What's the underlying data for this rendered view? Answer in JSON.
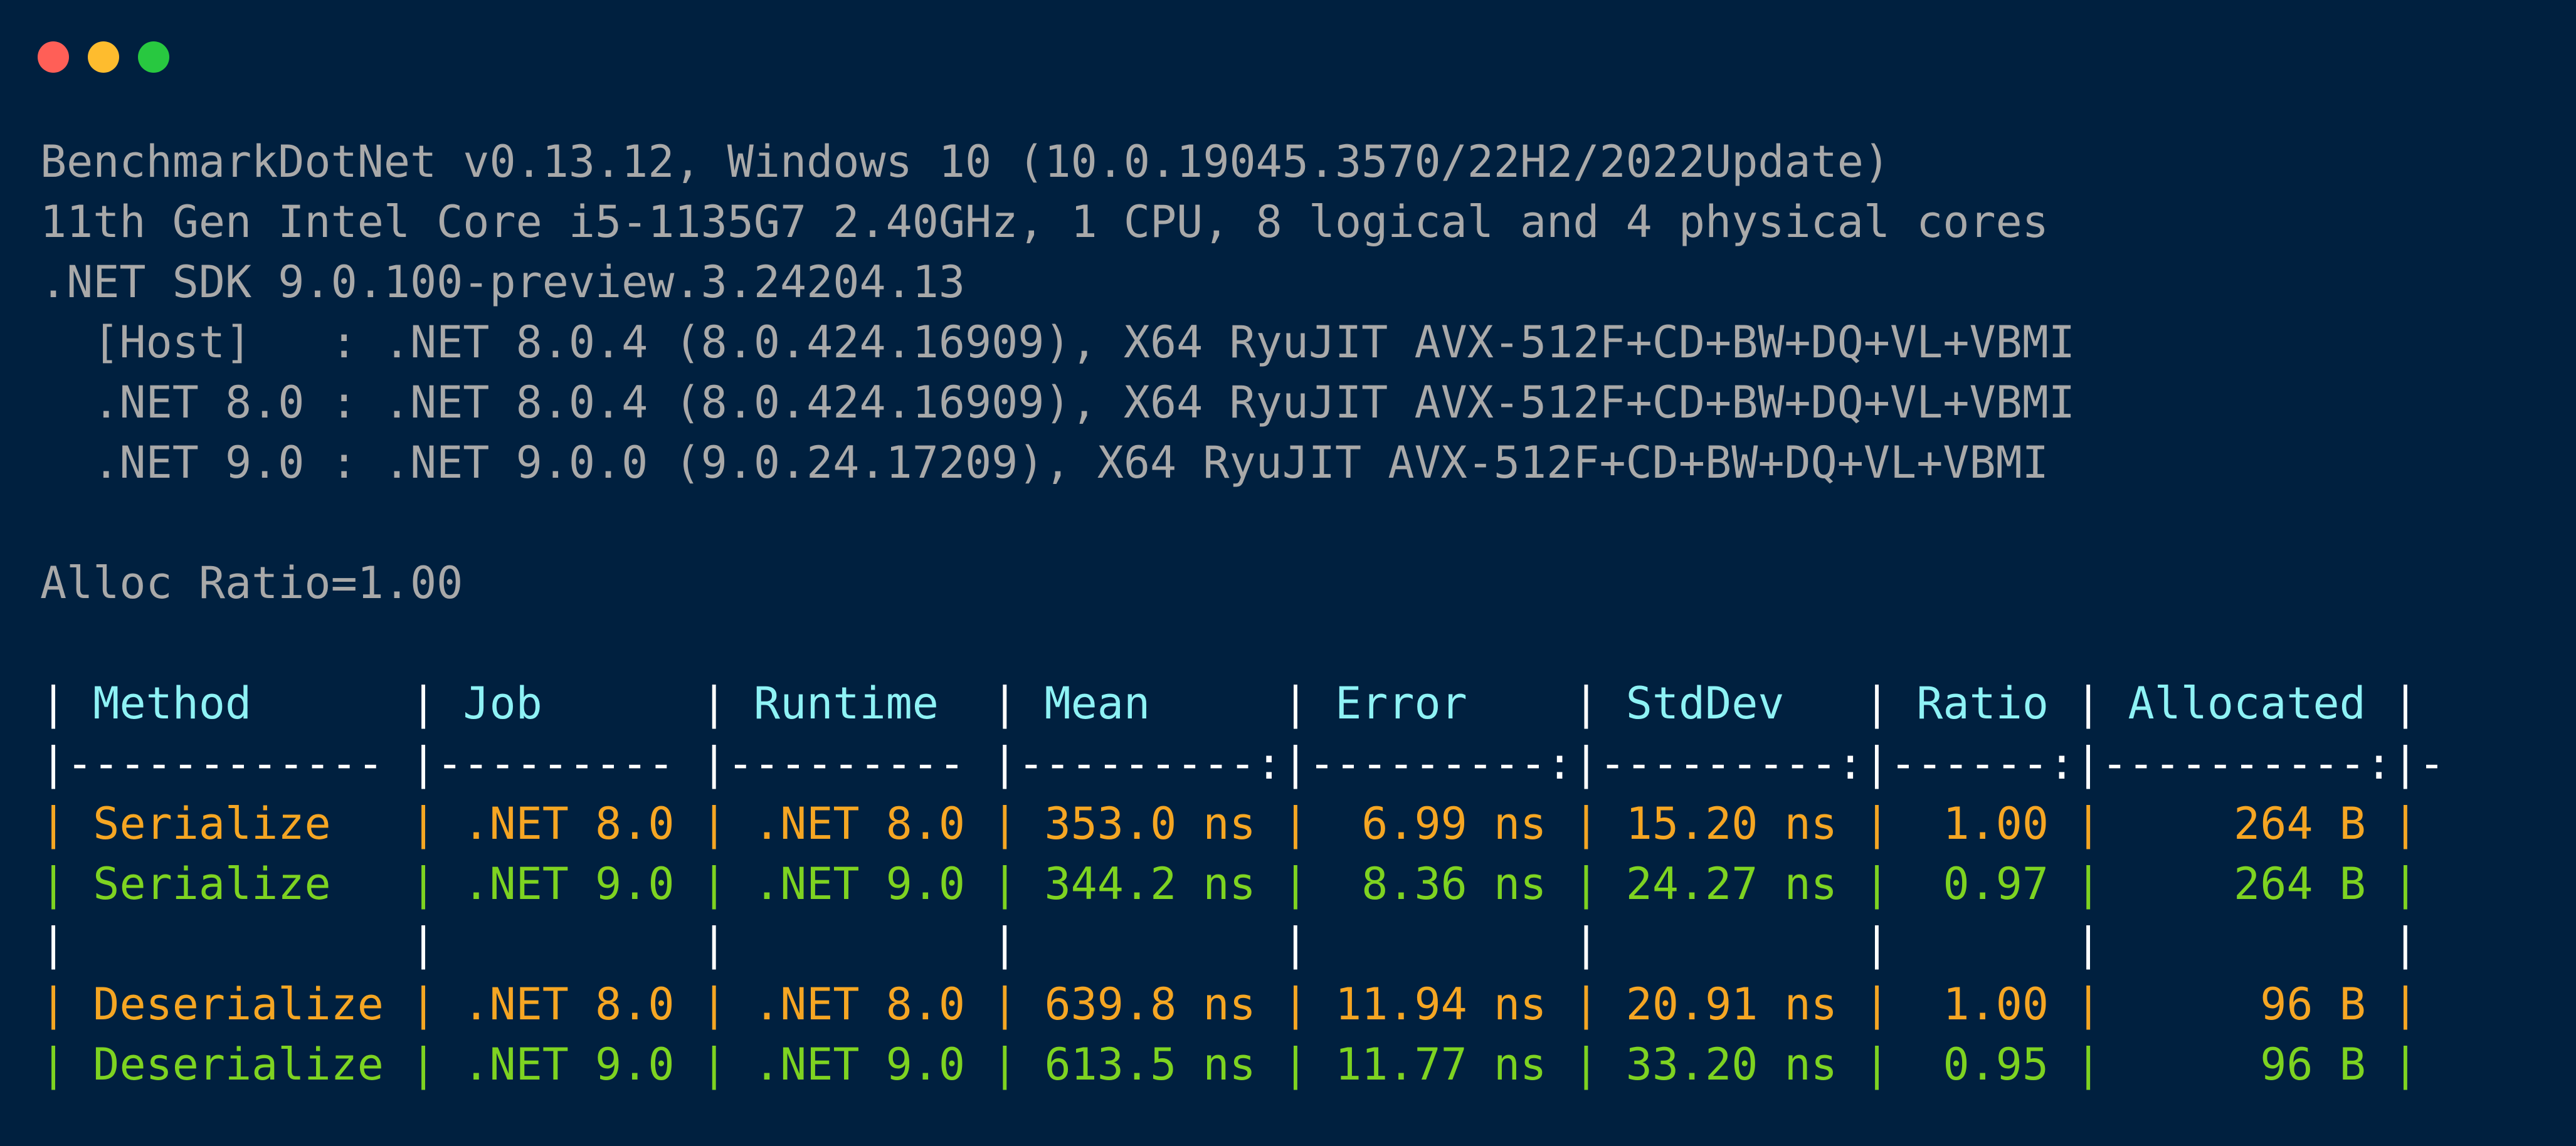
{
  "window": {
    "controls": [
      {
        "name": "close-dot",
        "color": "#ff5f57"
      },
      {
        "name": "minimize-dot",
        "color": "#febc2e"
      },
      {
        "name": "maximize-dot",
        "color": "#28c840"
      }
    ]
  },
  "colors": {
    "background": "#00203f",
    "default_text": "#a9a9a9",
    "header_text": "#8ef2f5",
    "net8_row": "#f5a623",
    "net9_row": "#7ed321"
  },
  "info": {
    "line1": "BenchmarkDotNet v0.13.12, Windows 10 (10.0.19045.3570/22H2/2022Update)",
    "line2": "11th Gen Intel Core i5-1135G7 2.40GHz, 1 CPU, 8 logical and 4 physical cores",
    "line3": ".NET SDK 9.0.100-preview.3.24204.13",
    "line4": "  [Host]   : .NET 8.0.4 (8.0.424.16909), X64 RyuJIT AVX-512F+CD+BW+DQ+VL+VBMI",
    "line5": "  .NET 8.0 : .NET 8.0.4 (8.0.424.16909), X64 RyuJIT AVX-512F+CD+BW+DQ+VL+VBMI",
    "line6": "  .NET 9.0 : .NET 9.0.0 (9.0.24.17209), X64 RyuJIT AVX-512F+CD+BW+DQ+VL+VBMI",
    "alloc_ratio": "Alloc Ratio=1.00"
  },
  "table": {
    "pipe": "|",
    "headers": {
      "method": " Method      ",
      "job": " Job      ",
      "runtime": " Runtime  ",
      "mean": " Mean     ",
      "error": " Error    ",
      "stddev": " StdDev   ",
      "ratio": " Ratio ",
      "allocated": " Allocated "
    },
    "separator": "|------------ |--------- |--------- |---------:|---------:|---------:|------:|----------:|-",
    "blank_row": "|             |          |          |          |          |          |       |           |",
    "rows": [
      {
        "method": " Serialize   ",
        "job": " .NET 8.0 ",
        "runtime": " .NET 8.0 ",
        "mean": " 353.0 ns ",
        "error": "  6.99 ns ",
        "stddev": " 15.20 ns ",
        "ratio": "  1.00 ",
        "allocated": "     264 B "
      },
      {
        "method": " Serialize   ",
        "job": " .NET 9.0 ",
        "runtime": " .NET 9.0 ",
        "mean": " 344.2 ns ",
        "error": "  8.36 ns ",
        "stddev": " 24.27 ns ",
        "ratio": "  0.97 ",
        "allocated": "     264 B "
      },
      {
        "method": " Deserialize ",
        "job": " .NET 8.0 ",
        "runtime": " .NET 8.0 ",
        "mean": " 639.8 ns ",
        "error": " 11.94 ns ",
        "stddev": " 20.91 ns ",
        "ratio": "  1.00 ",
        "allocated": "      96 B "
      },
      {
        "method": " Deserialize ",
        "job": " .NET 9.0 ",
        "runtime": " .NET 9.0 ",
        "mean": " 613.5 ns ",
        "error": " 11.77 ns ",
        "stddev": " 33.20 ns ",
        "ratio": "  0.95 ",
        "allocated": "      96 B "
      }
    ]
  }
}
